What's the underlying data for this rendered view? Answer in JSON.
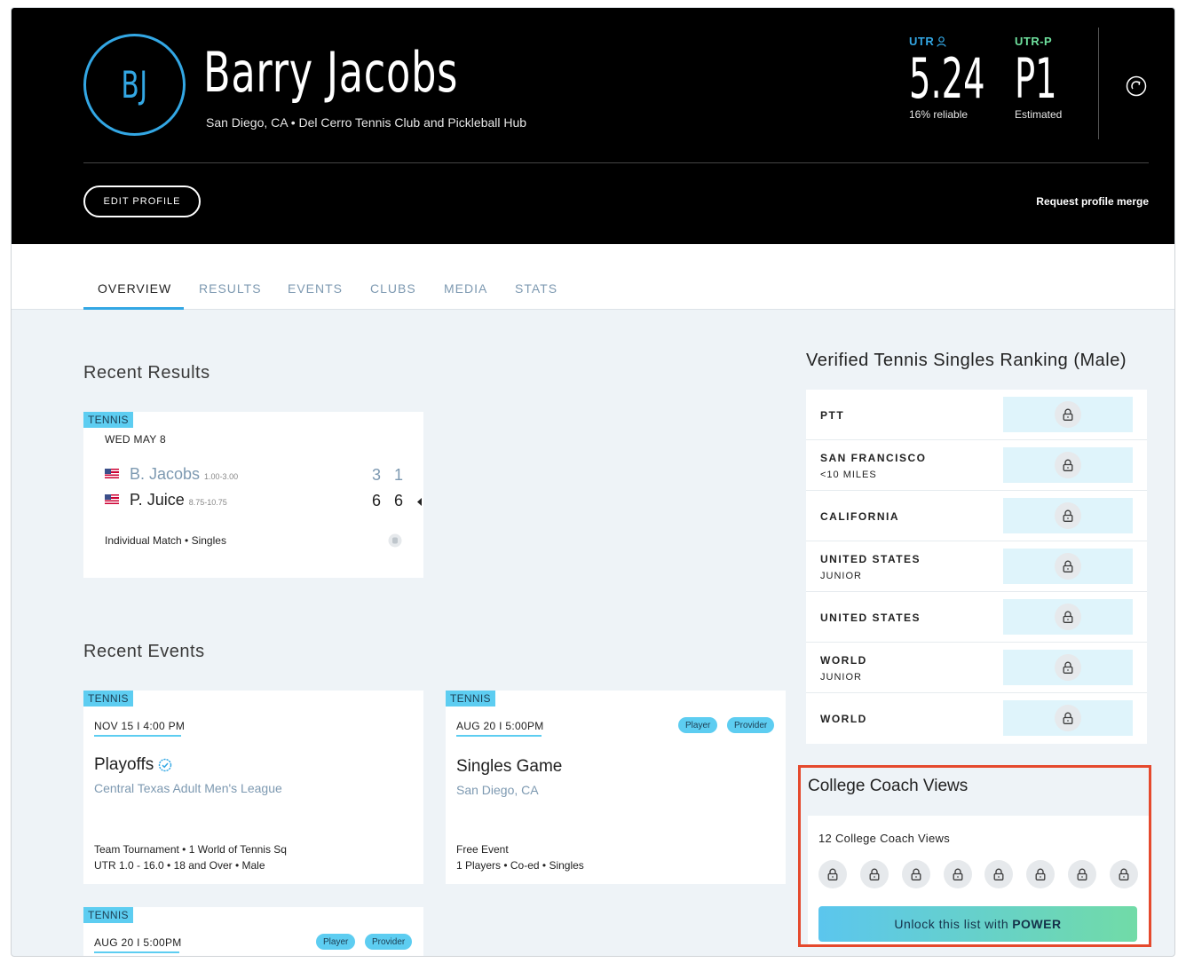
{
  "header": {
    "initials": "BJ",
    "name": "Barry Jacobs",
    "location": "San Diego, CA • Del Cerro Tennis Club and Pickleball Hub",
    "utr": {
      "label": "UTR",
      "value": "5.24",
      "sub": "16% reliable"
    },
    "utr_p": {
      "label": "UTR-P",
      "value": "P1",
      "sub": "Estimated"
    },
    "edit_profile": "EDIT PROFILE",
    "request_merge": "Request profile merge"
  },
  "tabs": [
    "OVERVIEW",
    "RESULTS",
    "EVENTS",
    "CLUBS",
    "MEDIA",
    "STATS"
  ],
  "recent_results": {
    "title": "Recent Results",
    "card": {
      "tag": "TENNIS",
      "date": "WED MAY 8",
      "players": [
        {
          "name": "B. Jacobs",
          "range": "1.00-3.00",
          "scores": [
            "3",
            "1"
          ]
        },
        {
          "name": "P. Juice",
          "range": "8.75-10.75",
          "scores": [
            "6",
            "6"
          ]
        }
      ],
      "match_type": "Individual Match • Singles"
    }
  },
  "recent_events": {
    "title": "Recent Events",
    "events": [
      {
        "tag": "TENNIS",
        "datetime": "NOV 15 I 4:00 PM",
        "name": "Playoffs",
        "subtitle": "Central Texas Adult Men's League",
        "meta1": "Team Tournament • 1 World of Tennis Sq",
        "meta2": "UTR 1.0 - 16.0 • 18 and Over • Male"
      },
      {
        "tag": "TENNIS",
        "datetime": "AUG 20 I 5:00PM",
        "badges": [
          "Player",
          "Provider"
        ],
        "name": "Singles Game",
        "subtitle": "San Diego, CA",
        "meta1": "Free Event",
        "meta2": "1 Players • Co-ed • Singles"
      },
      {
        "tag": "TENNIS",
        "datetime": "AUG 20 I 5:00PM",
        "badges": [
          "Player",
          "Provider"
        ]
      }
    ]
  },
  "rankings": {
    "title": "Verified Tennis Singles Ranking (Male)",
    "rows": [
      {
        "label": "PTT",
        "sub": ""
      },
      {
        "label": "SAN FRANCISCO",
        "sub": "<10 MILES"
      },
      {
        "label": "CALIFORNIA",
        "sub": ""
      },
      {
        "label": "UNITED STATES",
        "sub": "JUNIOR"
      },
      {
        "label": "UNITED STATES",
        "sub": ""
      },
      {
        "label": "WORLD",
        "sub": "JUNIOR"
      },
      {
        "label": "WORLD",
        "sub": ""
      }
    ]
  },
  "college_coach": {
    "title": "College Coach Views",
    "count_text": "12 College Coach Views",
    "unlock_prefix": "Unlock this list with",
    "unlock_bold": "POWER"
  }
}
